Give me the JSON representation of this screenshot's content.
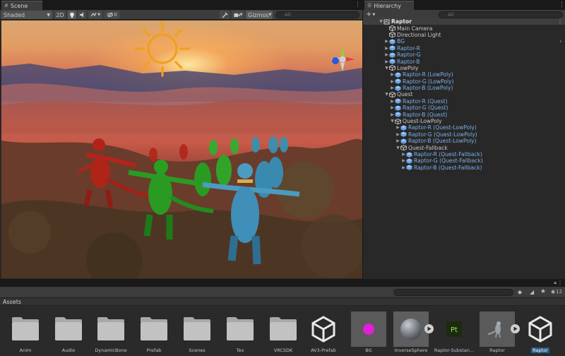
{
  "scene": {
    "tab_label": "Scene",
    "shading_mode": "Shaded",
    "dim_toggle": "2D",
    "hidden_count": "0",
    "gizmos_label": "Gizmos",
    "search_placeholder": "All"
  },
  "hierarchy": {
    "tab_label": "Hierarchy",
    "search_placeholder": "All",
    "items": [
      {
        "label": "Raptor",
        "depth": 0,
        "arrow": "down",
        "icon": "scene-icon",
        "style": "bold"
      },
      {
        "label": "Main Camera",
        "depth": 1,
        "arrow": "",
        "icon": "gameobject-icon",
        "style": "plain"
      },
      {
        "label": "Directional Light",
        "depth": 1,
        "arrow": "",
        "icon": "gameobject-icon",
        "style": "plain"
      },
      {
        "label": "BG",
        "depth": 1,
        "arrow": "right",
        "icon": "prefab-icon",
        "style": "prefab"
      },
      {
        "label": "Raptor-R",
        "depth": 1,
        "arrow": "right",
        "icon": "prefab-icon",
        "style": "prefab"
      },
      {
        "label": "Raptor-G",
        "depth": 1,
        "arrow": "right",
        "icon": "prefab-icon",
        "style": "prefab"
      },
      {
        "label": "Raptor-B",
        "depth": 1,
        "arrow": "right",
        "icon": "prefab-icon",
        "style": "prefab"
      },
      {
        "label": "LowPoly",
        "depth": 1,
        "arrow": "down",
        "icon": "gameobject-icon",
        "style": "plain"
      },
      {
        "label": "Raptor-R (LowPoly)",
        "depth": 2,
        "arrow": "right",
        "icon": "prefab-icon",
        "style": "prefab"
      },
      {
        "label": "Raptor-G (LowPoly)",
        "depth": 2,
        "arrow": "right",
        "icon": "prefab-icon",
        "style": "prefab"
      },
      {
        "label": "Raptor-B (LowPoly)",
        "depth": 2,
        "arrow": "right",
        "icon": "prefab-icon",
        "style": "prefab"
      },
      {
        "label": "Quest",
        "depth": 1,
        "arrow": "down",
        "icon": "gameobject-icon",
        "style": "plain"
      },
      {
        "label": "Raptor-R (Quest)",
        "depth": 2,
        "arrow": "right",
        "icon": "prefab-icon",
        "style": "prefab"
      },
      {
        "label": "Raptor-G (Quest)",
        "depth": 2,
        "arrow": "right",
        "icon": "prefab-icon",
        "style": "prefab"
      },
      {
        "label": "Raptor-B (Quest)",
        "depth": 2,
        "arrow": "right",
        "icon": "prefab-icon",
        "style": "prefab"
      },
      {
        "label": "Quest-LowPoly",
        "depth": 2,
        "arrow": "down",
        "icon": "gameobject-icon",
        "style": "plain"
      },
      {
        "label": "Raptor-R (Quest-LowPoly)",
        "depth": 3,
        "arrow": "right",
        "icon": "prefab-icon",
        "style": "prefab"
      },
      {
        "label": "Raptor-G (Quest-LowPoly)",
        "depth": 3,
        "arrow": "right",
        "icon": "prefab-icon",
        "style": "prefab"
      },
      {
        "label": "Raptor-B (Quest-LowPoly)",
        "depth": 3,
        "arrow": "right",
        "icon": "prefab-icon",
        "style": "prefab"
      },
      {
        "label": "Quest-Fallback",
        "depth": 3,
        "arrow": "down",
        "icon": "gameobject-icon",
        "style": "plain"
      },
      {
        "label": "Raptor-R (Quest-Fallback)",
        "depth": 4,
        "arrow": "right",
        "icon": "prefab-icon",
        "style": "prefab"
      },
      {
        "label": "Raptor-G (Quest-Fallback)",
        "depth": 4,
        "arrow": "right",
        "icon": "prefab-icon",
        "style": "prefab"
      },
      {
        "label": "Raptor-B (Quest-Fallback)",
        "depth": 4,
        "arrow": "right",
        "icon": "prefab-icon",
        "style": "prefab"
      }
    ]
  },
  "project": {
    "breadcrumb": "Assets",
    "hidden_count": "12",
    "assets": [
      {
        "label": "Anim",
        "kind": "folder"
      },
      {
        "label": "Audio",
        "kind": "folder"
      },
      {
        "label": "DynamicBone",
        "kind": "folder"
      },
      {
        "label": "Prefab",
        "kind": "folder"
      },
      {
        "label": "Scenes",
        "kind": "folder"
      },
      {
        "label": "Tex",
        "kind": "folder"
      },
      {
        "label": "VRCSDK",
        "kind": "folder"
      },
      {
        "label": "AV3-Prefab",
        "kind": "unity-logo"
      },
      {
        "label": "BG",
        "kind": "material"
      },
      {
        "label": "InverseSphere",
        "kind": "model"
      },
      {
        "label": "Raptor-Substan...",
        "kind": "substance"
      },
      {
        "label": "Raptor",
        "kind": "raptor-model"
      },
      {
        "label": "Raptor",
        "kind": "unity-logo-selected"
      }
    ]
  },
  "colors": {
    "panel_bg": "#282828",
    "toolbar_bg": "#3c3c3c",
    "prefab_text": "#7bafe8",
    "selection": "#2c5d87",
    "bg_material": "#e21fd6",
    "substance_badge": "#1b2b10",
    "substance_text": "#a8e23a"
  }
}
